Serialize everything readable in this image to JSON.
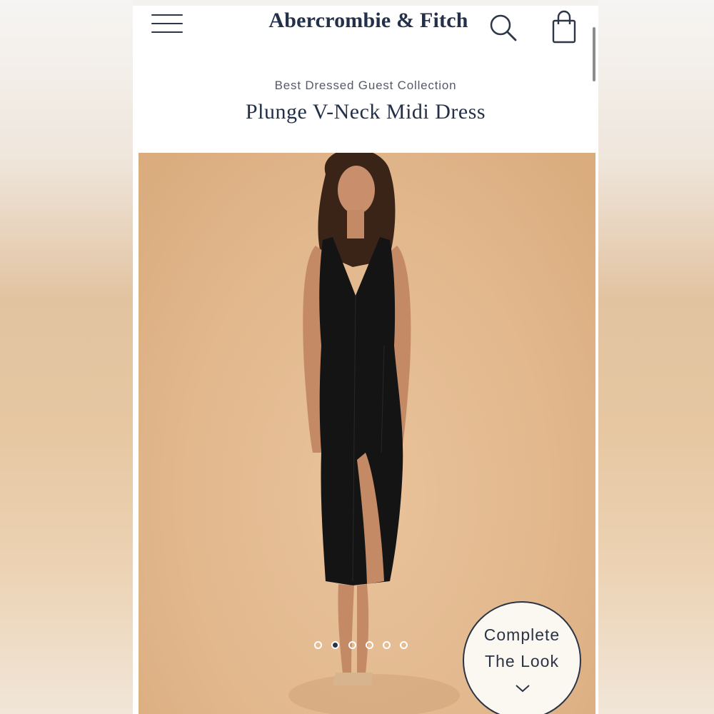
{
  "header": {
    "brand": "Abercrombie & Fitch",
    "menu_icon": "hamburger-menu-icon",
    "search_icon": "search-icon",
    "bag_icon": "shopping-bag-icon"
  },
  "product": {
    "collection": "Best Dressed Guest Collection",
    "title": "Plunge V-Neck Midi Dress"
  },
  "gallery": {
    "image_count": 6,
    "active_index": 1
  },
  "complete_look": {
    "line1": "Complete",
    "line2": "The Look",
    "icon": "chevron-down-icon"
  },
  "colors": {
    "brand_navy": "#23304a",
    "image_background": "#e2b88d",
    "dress": "#151414"
  }
}
